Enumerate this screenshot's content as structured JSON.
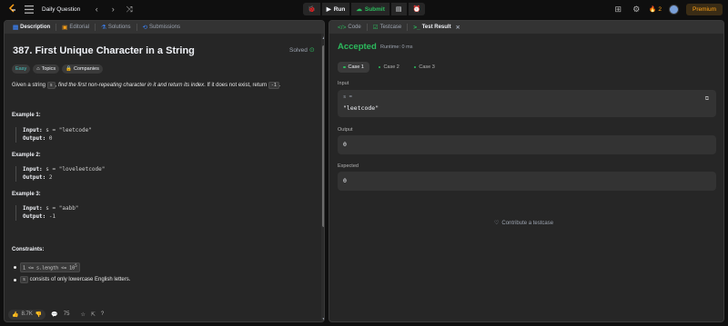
{
  "topbar": {
    "daily_question": "Daily Question",
    "run_label": "Run",
    "submit_label": "Submit",
    "streak_count": "2",
    "premium_label": "Premium"
  },
  "left_tabs": [
    "Description",
    "Editorial",
    "Solutions",
    "Submissions"
  ],
  "problem": {
    "title": "387. First Unique Character in a String",
    "status": "Solved",
    "difficulty": "Easy",
    "topics_label": "Topics",
    "companies_label": "Companies",
    "desc_prefix": "Given a string ",
    "desc_var": "s",
    "desc_mid": ", find the first non-repeating character in it and return its index",
    "desc_suffix": ". If it does not exist, return ",
    "desc_return": "-1",
    "desc_end": "."
  },
  "examples": [
    {
      "title": "Example 1:",
      "input_label": "Input:",
      "input": " s = \"leetcode\"",
      "output_label": "Output:",
      "output": " 0"
    },
    {
      "title": "Example 2:",
      "input_label": "Input:",
      "input": " s = \"loveleetcode\"",
      "output_label": "Output:",
      "output": " 2"
    },
    {
      "title": "Example 3:",
      "input_label": "Input:",
      "input": " s = \"aabb\"",
      "output_label": "Output:",
      "output": " -1"
    }
  ],
  "constraints": {
    "title": "Constraints:",
    "c1": "1 <= s.length <= 10",
    "c1_sup": "5",
    "c2_code": "s",
    "c2_text": " consists of only lowercase English letters."
  },
  "footer": {
    "likes": "8.7K",
    "comments": "75"
  },
  "right_tabs": [
    "Code",
    "Testcase",
    "Test Result"
  ],
  "result": {
    "status": "Accepted",
    "runtime": "Runtime: 0 ms",
    "cases": [
      "Case 1",
      "Case 2",
      "Case 3"
    ],
    "input_label": "Input",
    "input_key": "s =",
    "input_value": "\"leetcode\"",
    "output_label": "Output",
    "output_value": "0",
    "expected_label": "Expected",
    "expected_value": "0",
    "contribute": "Contribute a testcase"
  },
  "colors": {
    "accent_green": "#2cbb5d",
    "accent_orange": "#ffa116",
    "easy_teal": "#46c6c2"
  }
}
